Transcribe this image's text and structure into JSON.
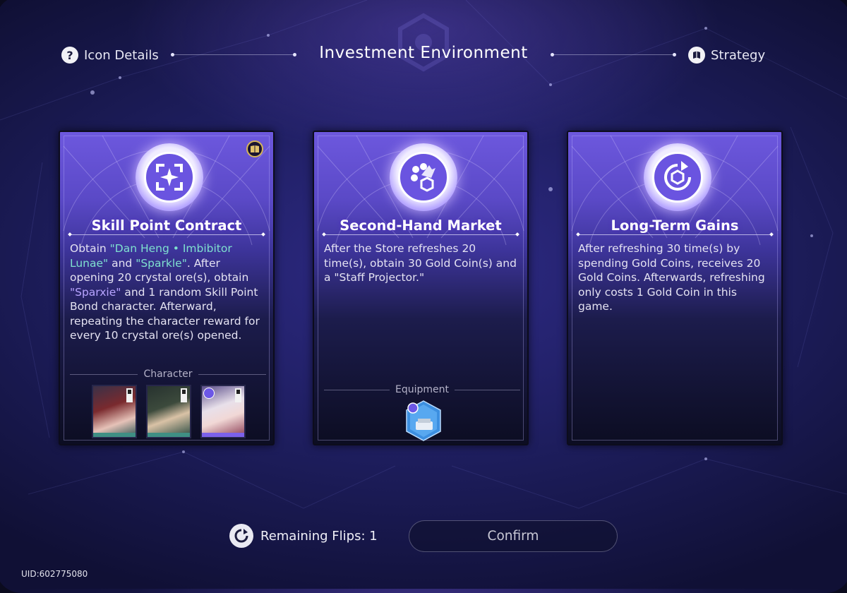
{
  "header": {
    "title": "Investment Environment",
    "left_link": "Icon Details",
    "left_icon": "question-circle-icon",
    "right_link": "Strategy",
    "right_icon": "book-circle-icon"
  },
  "cards": [
    {
      "title": "Skill Point Contract",
      "icon": "sparkle-star-icon",
      "badge_icon": "book-badge-icon",
      "description": {
        "p1": "Obtain ",
        "hl1": "\"Dan Heng • Imbibitor Lunae\"",
        "p2": " and ",
        "hl2": "\"Sparkle\"",
        "p3": ". After opening 20 crystal ore(s), obtain ",
        "hl3": "\"Sparxie\"",
        "p4": " and 1 random Skill Point Bond character. Afterward, repeating the character reward for every 10 crystal ore(s) opened."
      },
      "section_label": "Character",
      "portraits": [
        "sparkle-portrait",
        "dan-heng-portrait",
        "sparxie-portrait"
      ]
    },
    {
      "title": "Second-Hand Market",
      "icon": "market-icon",
      "description": "After the Store refreshes 20 time(s), obtain 30 Gold Coin(s) and a \"Staff Projector.\"",
      "section_label": "Equipment",
      "equipment_icon": "staff-projector-icon"
    },
    {
      "title": "Long-Term Gains",
      "icon": "refresh-coin-icon",
      "description": "After refreshing 30 time(s) by spending Gold Coins, receives 20 Gold Coins. Afterwards, refreshing only costs 1 Gold Coin in this game."
    }
  ],
  "footer": {
    "remaining_flips": "Remaining Flips: 1",
    "confirm_label": "Confirm",
    "uid": "UID:602775080"
  },
  "colors": {
    "background": "#1d1d5c",
    "card_top": "#6d58de",
    "highlight_green": "#7fe0cf",
    "highlight_purple": "#b7a4ff"
  }
}
